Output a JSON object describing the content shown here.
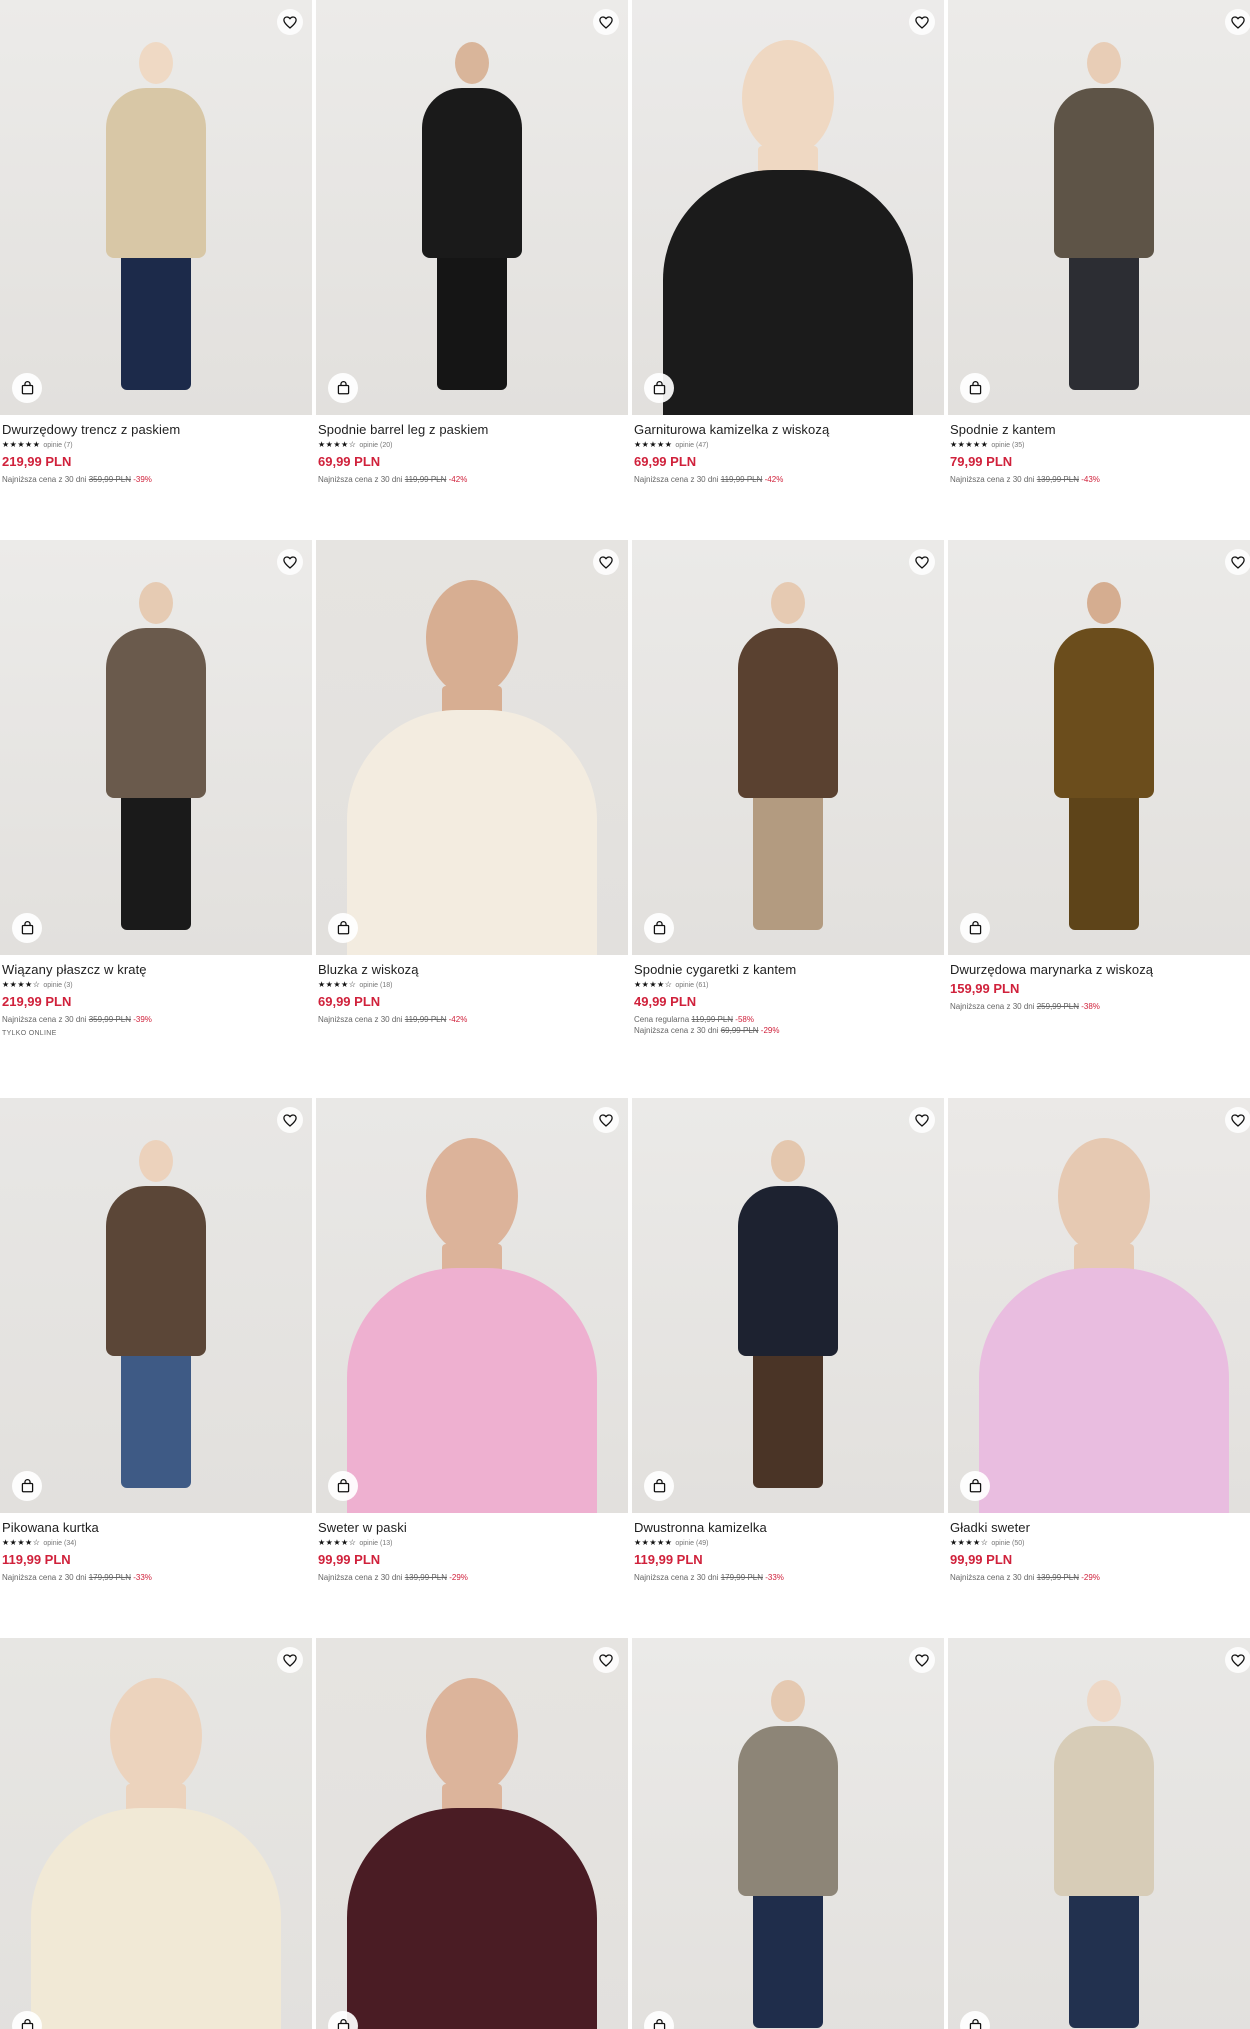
{
  "products": [
    {
      "name": "Dwurzędowy trencz z paskiem",
      "stars": "★★★★★",
      "reviews": "opinie (7)",
      "price": "219,99 PLN",
      "note_prefix": "Najniższa cena z 30 dni",
      "note_old": "359,99 PLN",
      "note_disc": "-39%",
      "colors": {
        "bg": "#ecebe9",
        "top": "#d8c7a6",
        "bottom": "#1c2a4a",
        "skin": "#efd9c4"
      }
    },
    {
      "name": "Spodnie barrel leg z paskiem",
      "stars": "★★★★☆",
      "reviews": "opinie (20)",
      "price": "69,99 PLN",
      "note_prefix": "Najniższa cena z 30 dni",
      "note_old": "119,99 PLN",
      "note_disc": "-42%",
      "colors": {
        "bg": "#ecebe9",
        "top": "#1a1a1a",
        "bottom": "#151515",
        "skin": "#d9b59a"
      }
    },
    {
      "name": "Garniturowa kamizelka z wiskozą",
      "stars": "★★★★★",
      "reviews": "opinie (47)",
      "price": "69,99 PLN",
      "note_prefix": "Najniższa cena z 30 dni",
      "note_old": "119,99 PLN",
      "note_disc": "-42%",
      "colors": {
        "bg": "#ecebea",
        "top": "#1b1b1b",
        "bottom": "#f4f2ee",
        "skin": "#efd8c2"
      }
    },
    {
      "name": "Spodnie z kantem",
      "stars": "★★★★★",
      "reviews": "opinie (35)",
      "price": "79,99 PLN",
      "note_prefix": "Najniższa cena z 30 dni",
      "note_old": "139,99 PLN",
      "note_disc": "-43%",
      "colors": {
        "bg": "#ecebe9",
        "top": "#5e5447",
        "bottom": "#2c2d33",
        "skin": "#e8cdb6"
      }
    },
    {
      "name": "Wiązany płaszcz w kratę",
      "stars": "★★★★☆",
      "reviews": "opinie (3)",
      "price": "219,99 PLN",
      "note_prefix": "Najniższa cena z 30 dni",
      "note_old": "359,99 PLN",
      "note_disc": "-39%",
      "extra": "TYLKO ONLINE",
      "colors": {
        "bg": "#ecebe9",
        "top": "#6a5a4c",
        "bottom": "#1a1a1a",
        "skin": "#e6cbb3"
      }
    },
    {
      "name": "Bluzka z wiskozą",
      "stars": "★★★★☆",
      "reviews": "opinie (18)",
      "price": "69,99 PLN",
      "note_prefix": "Najniższa cena z 30 dni",
      "note_old": "119,99 PLN",
      "note_disc": "-42%",
      "colors": {
        "bg": "#e6e4e1",
        "top": "#f3ece0",
        "bottom": "#f3ece0",
        "skin": "#d7ae92"
      }
    },
    {
      "name": "Spodnie cygaretki z kantem",
      "stars": "★★★★☆",
      "reviews": "opinie (61)",
      "price": "49,99 PLN",
      "note_prefix": "Cena regularna",
      "note_old": "119,99 PLN",
      "note_disc": "-58%",
      "note2_prefix": "Najniższa cena z 30 dni",
      "note2_old": "69,99 PLN",
      "note2_disc": "-29%",
      "colors": {
        "bg": "#ebeae8",
        "top": "#5a4130",
        "bottom": "#b39b80",
        "skin": "#e6cab2"
      }
    },
    {
      "name": "Dwurzędowa marynarka z wiskozą",
      "price": "159,99 PLN",
      "note_prefix": "Najniższa cena z 30 dni",
      "note_old": "259,99 PLN",
      "note_disc": "-38%",
      "colors": {
        "bg": "#ebeae8",
        "top": "#6b4d1c",
        "bottom": "#5e4419",
        "skin": "#d5ad90"
      }
    },
    {
      "name": "Pikowana kurtka",
      "stars": "★★★★☆",
      "reviews": "opinie (34)",
      "price": "119,99 PLN",
      "note_prefix": "Najniższa cena z 30 dni",
      "note_old": "179,99 PLN",
      "note_disc": "-33%",
      "colors": {
        "bg": "#e8e7e5",
        "top": "#5b4637",
        "bottom": "#3e5a85",
        "skin": "#ecd2bc"
      }
    },
    {
      "name": "Sweter w paski",
      "stars": "★★★★☆",
      "reviews": "opinie (13)",
      "price": "99,99 PLN",
      "note_prefix": "Najniższa cena z 30 dni",
      "note_old": "139,99 PLN",
      "note_disc": "-29%",
      "colors": {
        "bg": "#e9e8e6",
        "top": "#eeb0d0",
        "bottom": "#d9253b",
        "skin": "#dcb39a"
      }
    },
    {
      "name": "Dwustronna kamizelka",
      "stars": "★★★★★",
      "reviews": "opinie (49)",
      "price": "119,99 PLN",
      "note_prefix": "Najniższa cena z 30 dni",
      "note_old": "179,99 PLN",
      "note_disc": "-33%",
      "colors": {
        "bg": "#ebeae8",
        "top": "#1d2230",
        "bottom": "#4a3426",
        "skin": "#e4c7ae"
      }
    },
    {
      "name": "Gładki sweter",
      "stars": "★★★★☆",
      "reviews": "opinie (50)",
      "price": "99,99 PLN",
      "note_prefix": "Najniższa cena z 30 dni",
      "note_old": "139,99 PLN",
      "note_disc": "-29%",
      "colors": {
        "bg": "#ebe9e7",
        "top": "#e9bde0",
        "bottom": "#1c1c1c",
        "skin": "#e6c9b2"
      }
    },
    {
      "colors": {
        "bg": "#e7e6e3",
        "top": "#f1e9d6",
        "bottom": "#2d3e5c",
        "skin": "#ecd3bd"
      }
    },
    {
      "colors": {
        "bg": "#e6e4e1",
        "top": "#4a1c24",
        "bottom": "#4a1c24",
        "skin": "#dcb49b"
      }
    },
    {
      "colors": {
        "bg": "#ebeae8",
        "top": "#8d8577",
        "bottom": "#1f2d4b",
        "skin": "#e5c9b1"
      }
    },
    {
      "colors": {
        "bg": "#e9e8e6",
        "top": "#d7ccb7",
        "bottom": "#22314f",
        "skin": "#eed8c6"
      }
    }
  ],
  "icons": {
    "favorite": "heart-outline-icon",
    "bag": "shopping-bag-icon"
  }
}
